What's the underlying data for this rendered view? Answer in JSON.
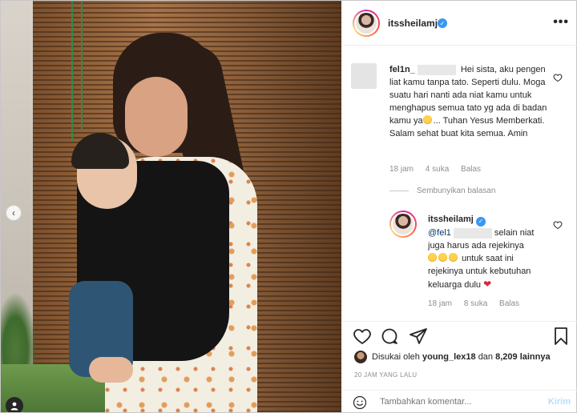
{
  "post": {
    "username": "itssheilamj",
    "more_icon": "•••"
  },
  "comment": {
    "username": "fel1n_",
    "text_line1": "Hei sista, aku pengen",
    "text_rest": "liat kamu tanpa tato. Seperti dulu. Moga suatu hari nanti ada niat kamu untuk menghapus semua tato yg ada di badan kamu ya",
    "text_end": "... Tuhan Yesus Memberkati. Salam sehat buat kita semua. Amin",
    "time": "18 jam",
    "likes": "4 suka",
    "reply_label": "Balas"
  },
  "hide_replies": "Sembunyikan balasan",
  "reply": {
    "username": "itssheilamj",
    "mention": "@fel1",
    "text_a": "selain niat juga harus ada rejekinya",
    "text_b": "untuk saat ini rejekinya untuk kebutuhan keluarga dulu",
    "time": "18 jam",
    "likes": "8 suka",
    "reply_label": "Balas"
  },
  "likes_line": {
    "prefix": "Disukai oleh",
    "user": "young_lex18",
    "middle": "dan",
    "count": "8,209 lainnya"
  },
  "timestamp": "20 JAM YANG LALU",
  "add_comment": {
    "placeholder": "Tambahkan komentar...",
    "send_label": "Kirim"
  },
  "colors": {
    "verified": "#3897f0",
    "send": "#b2dffc",
    "muted": "#8e8e8e"
  }
}
